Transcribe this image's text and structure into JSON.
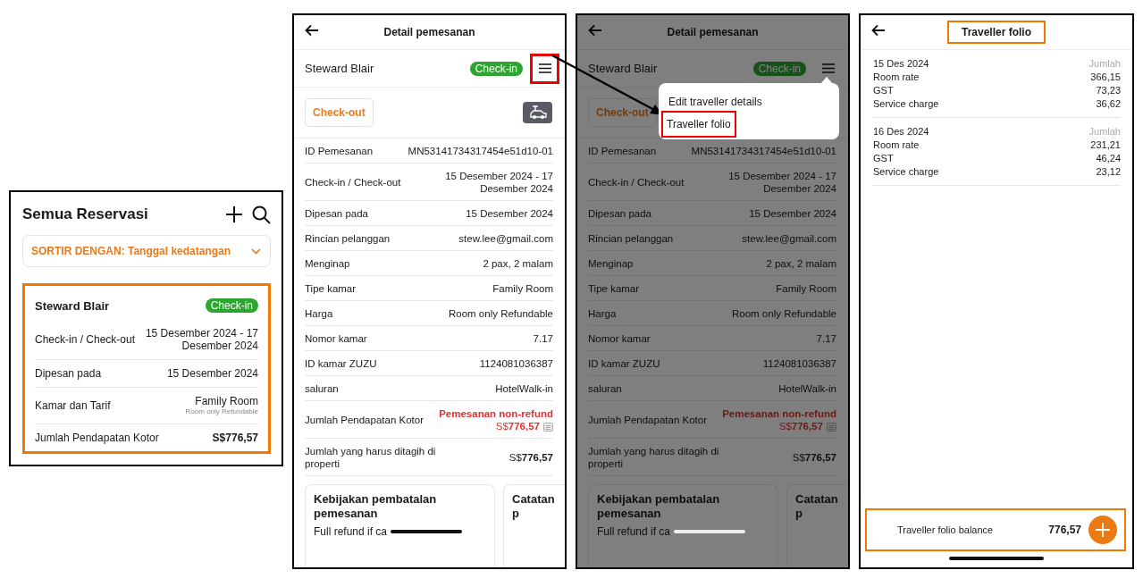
{
  "pointer_arrow": true,
  "reservations_screen": {
    "title": "Semua Reservasi",
    "sort": {
      "label": "SORTIR DENGAN: Tanggal kedatangan"
    },
    "card": {
      "highlighted": true,
      "guest": "Steward Blair",
      "status": "Check-in",
      "rows": [
        {
          "label": "Check-in / Check-out",
          "value": "15 Desember 2024 - 17 Desember 2024"
        },
        {
          "label": "Dipesan pada",
          "value": "15 Desember 2024"
        },
        {
          "label": "Kamar dan Tarif",
          "value": "Family Room",
          "note": "Room only Refundable"
        },
        {
          "label": "Jumlah Pendapatan Kotor",
          "value": "S$776,57",
          "kind": "total"
        }
      ]
    }
  },
  "detail_screens": [
    {
      "title": "Detail pemesanan",
      "guest": "Steward Blair",
      "status": "Check-in",
      "menu_button": {
        "highlighted": true
      },
      "checkout_button": "Check-out",
      "rows": [
        {
          "kind": "plain",
          "label": "ID Pemesanan",
          "value": "MN53141734317454e51d10-01"
        },
        {
          "kind": "plain",
          "label": "Check-in / Check-out",
          "value": "15 Desember 2024 - 17 Desember 2024"
        },
        {
          "kind": "plain",
          "label": "Dipesan pada",
          "value": "15 Desember 2024"
        },
        {
          "kind": "plain",
          "label": "Rincian pelanggan",
          "value": "stew.lee@gmail.com"
        },
        {
          "kind": "plain",
          "label": "Menginap",
          "value": "2 pax, 2 malam"
        },
        {
          "kind": "plain",
          "label": "Tipe kamar",
          "value": "Family Room"
        },
        {
          "kind": "plain",
          "label": "Harga",
          "value": "Room only Refundable"
        },
        {
          "kind": "plain",
          "label": "Nomor kamar",
          "value": "7.17"
        },
        {
          "kind": "plain",
          "label": "ID kamar ZUZU",
          "value": "1124081036387"
        },
        {
          "kind": "plain",
          "label": "saluran",
          "value": "HotelWalk-in"
        },
        {
          "kind": "refund",
          "label": "Jumlah Pendapatan Kotor",
          "value": "Pemesanan non-refund",
          "amount": "S$**776,57**"
        },
        {
          "kind": "plain",
          "label": "Jumlah yang harus ditagih di properti",
          "value": "S$**776,57**"
        }
      ],
      "cards": [
        {
          "title": "Kebijakan pembatalan pemesanan",
          "text": "Full refund if ca"
        },
        {
          "title": "Catatan p"
        }
      ]
    },
    {
      "title": "Detail pemesanan",
      "guest": "Steward Blair",
      "status": "Check-in",
      "menu_button": {
        "highlighted": false
      },
      "checkout_button": "Check-out",
      "dimmed": true,
      "menu": {
        "items": [
          {
            "label": "Edit traveller details",
            "highlighted": false
          },
          {
            "label": "Traveller folio",
            "highlighted": true
          }
        ]
      },
      "rows": [
        {
          "kind": "plain",
          "label": "ID Pemesanan",
          "value": "MN53141734317454e51d10-01"
        },
        {
          "kind": "plain",
          "label": "Check-in / Check-out",
          "value": "15 Desember 2024 - 17 Desember 2024"
        },
        {
          "kind": "plain",
          "label": "Dipesan pada",
          "value": "15 Desember 2024"
        },
        {
          "kind": "plain",
          "label": "Rincian pelanggan",
          "value": "stew.lee@gmail.com"
        },
        {
          "kind": "plain",
          "label": "Menginap",
          "value": "2 pax, 2 malam"
        },
        {
          "kind": "plain",
          "label": "Tipe kamar",
          "value": "Family Room"
        },
        {
          "kind": "plain",
          "label": "Harga",
          "value": "Room only Refundable"
        },
        {
          "kind": "plain",
          "label": "Nomor kamar",
          "value": "7.17"
        },
        {
          "kind": "plain",
          "label": "ID kamar ZUZU",
          "value": "1124081036387"
        },
        {
          "kind": "plain",
          "label": "saluran",
          "value": "HotelWalk-in"
        },
        {
          "kind": "refund",
          "label": "Jumlah Pendapatan Kotor",
          "value": "Pemesanan non-refund",
          "amount": "S$**776,57**"
        },
        {
          "kind": "plain",
          "label": "Jumlah yang harus ditagih di properti",
          "value": "S$**776,57**"
        }
      ],
      "cards": [
        {
          "title": "Kebijakan pembatalan pemesanan",
          "text": "Full refund if ca"
        },
        {
          "title": "Catatan p"
        }
      ]
    }
  ],
  "folio_screen": {
    "title": "Traveller folio",
    "title_highlighted": true,
    "days": [
      {
        "date": "15 Des 2024",
        "column": "Jumlah",
        "lines": [
          {
            "label": "Room rate",
            "amount": "366,15"
          },
          {
            "label": "GST",
            "amount": "73,23"
          },
          {
            "label": "Service charge",
            "amount": "36,62"
          }
        ]
      },
      {
        "date": "16 Des 2024",
        "column": "Jumlah",
        "lines": [
          {
            "label": "Room rate",
            "amount": "231,21"
          },
          {
            "label": "GST",
            "amount": "46,24"
          },
          {
            "label": "Service charge",
            "amount": "23,12"
          }
        ]
      }
    ],
    "balance": {
      "label": "Traveller folio balance",
      "amount": "776,57",
      "highlighted": true
    }
  }
}
